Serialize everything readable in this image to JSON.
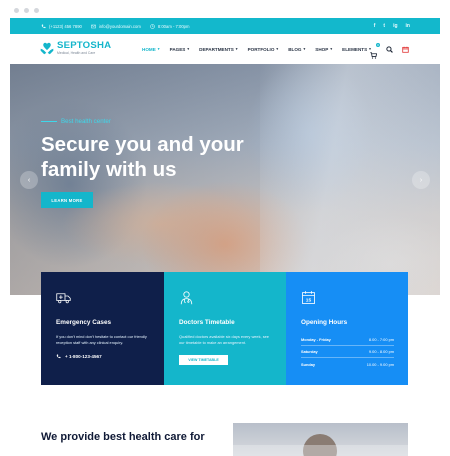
{
  "topbar": {
    "phone": "(+1123) 456 7890",
    "email": "info@yourdomain.com",
    "hours": "8:00am - 7:00pm",
    "social": [
      "f",
      "t",
      "ig",
      "in"
    ]
  },
  "header": {
    "logo_name": "SEPTOSHA",
    "logo_tagline": "Medical, Health and Care",
    "nav": [
      {
        "label": "HOME"
      },
      {
        "label": "PAGES"
      },
      {
        "label": "DEPARTMENTS"
      },
      {
        "label": "PORTFOLIO"
      },
      {
        "label": "BLOG"
      },
      {
        "label": "SHOP"
      },
      {
        "label": "ELEMENTS"
      }
    ],
    "cart_count": "0"
  },
  "hero": {
    "eyebrow": "Best health center",
    "title": "Secure you and your family with us",
    "button": "LEARN MORE",
    "prev": "‹",
    "next": "›"
  },
  "cards": {
    "emergency": {
      "title": "Emergency Cases",
      "text": "If you don't mind don't hesitate to contact our friendly reception staff with any clinical enquiry.",
      "phone": "+ 1-800-123-4567"
    },
    "timetable": {
      "title": "Doctors Timetable",
      "text": "Qualified doctors available six days every week, see our timetable to make an arrangement.",
      "button": "VIEW TIMETABLE"
    },
    "opening": {
      "title": "Opening Hours",
      "rows": [
        {
          "day": "Monday - Friday",
          "time": "8.00 - 7:00 pm"
        },
        {
          "day": "Saturday",
          "time": "9.00 - 8.00 pm"
        },
        {
          "day": "Sunday",
          "time": "10.00 - 9.00 pm"
        }
      ]
    }
  },
  "bottom": {
    "title": "We provide best health care for"
  },
  "colors": {
    "accent": "#14b6cb",
    "navy": "#0f1f4a",
    "blue": "#168ef5"
  }
}
